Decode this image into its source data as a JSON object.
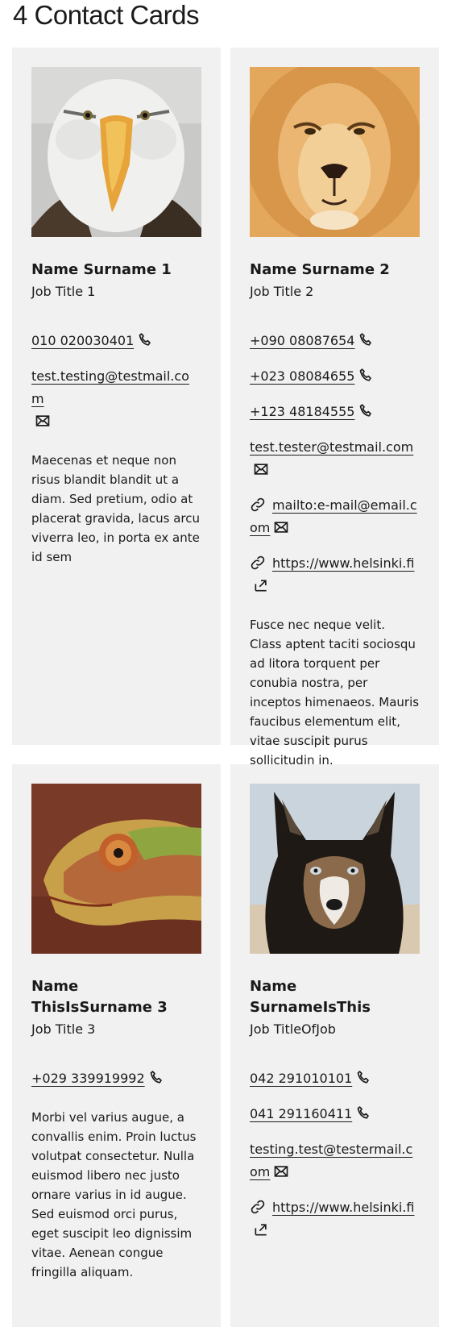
{
  "page": {
    "title": "4 Contact Cards"
  },
  "cards": [
    {
      "name": "Name Surname 1",
      "job": "Job Title 1",
      "image": "eagle-photo",
      "phones": [
        "010 020030401"
      ],
      "email": "test.testing@testmail.com",
      "description": "Maecenas et neque non risus blandit blandit ut a diam. Sed pretium, odio at placerat gravida, lacus arcu viverra leo, in porta ex ante id sem"
    },
    {
      "name": "Name Surname 2",
      "job": "Job Title 2",
      "image": "lion-photo",
      "phones": [
        "+090 08087654",
        "+023 08084655",
        "+123 48184555"
      ],
      "email": "test.tester@testmail.com",
      "mailto": "mailto:e-mail@email.com",
      "url": "https://www.helsinki.fi",
      "description": "Fusce nec neque velit. Class aptent taciti sociosqu ad litora torquent per conubia nostra, per inceptos himenaeos. Mauris faucibus elementum elit, vitae suscipit purus sollicitudin in."
    },
    {
      "name": "Name ThisIsSurname 3",
      "job": "Job Title 3",
      "image": "chameleon-photo",
      "phones": [
        "+029 339919992"
      ],
      "description": "Morbi vel varius augue, a convallis enim. Proin luctus volutpat consectetur. Nulla euismod libero nec justo ornare varius in id augue. Sed euismod orci purus, eget suscipit leo dignissim vitae. Aenean congue fringilla aliquam."
    },
    {
      "name": "Name SurnameIsThis",
      "job": "Job TitleOfJob",
      "image": "husky-photo",
      "phones": [
        "042 291010101",
        "041 291160411"
      ],
      "email": "testing.test@testermail.com",
      "url": "https://www.helsinki.fi"
    }
  ],
  "icons": {
    "phone": "phone-icon",
    "email": "envelope-icon",
    "link": "link-icon",
    "external": "external-link-icon"
  }
}
